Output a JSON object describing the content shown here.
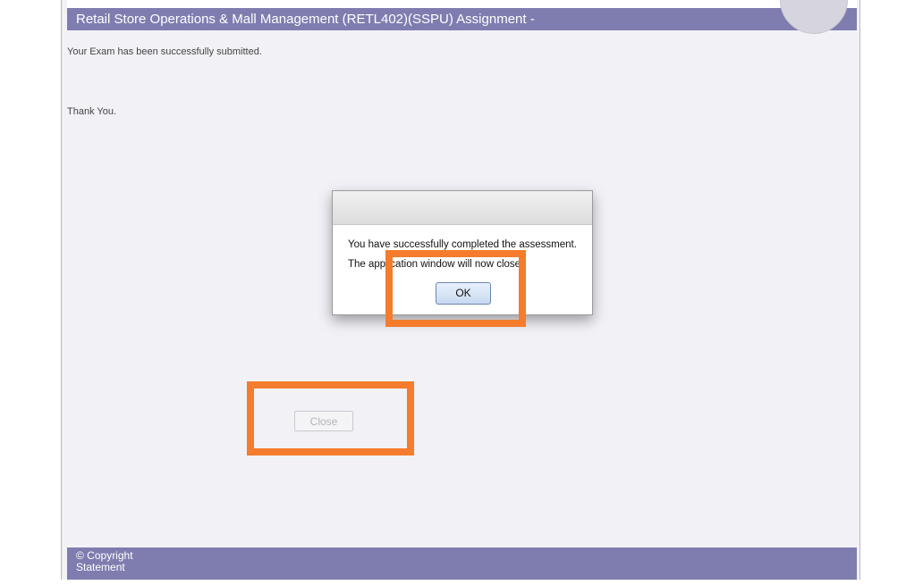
{
  "header": {
    "title": "Retail Store Operations & Mall Management (RETL402)(SSPU) Assignment -"
  },
  "content": {
    "submitted_message": "Your Exam has been successfully submitted.",
    "thank_you": "Thank You.",
    "close_button": "Close"
  },
  "dialog": {
    "line1": "You have successfully completed the assessment.",
    "line2": "The application window will now close.",
    "ok_button": "OK"
  },
  "footer": {
    "copyright": "© Copyright",
    "statement": "Statement"
  },
  "colors": {
    "header_bar": "#7f7daf",
    "highlight": "#f47c2c",
    "page_background": "#f2f1f6"
  }
}
